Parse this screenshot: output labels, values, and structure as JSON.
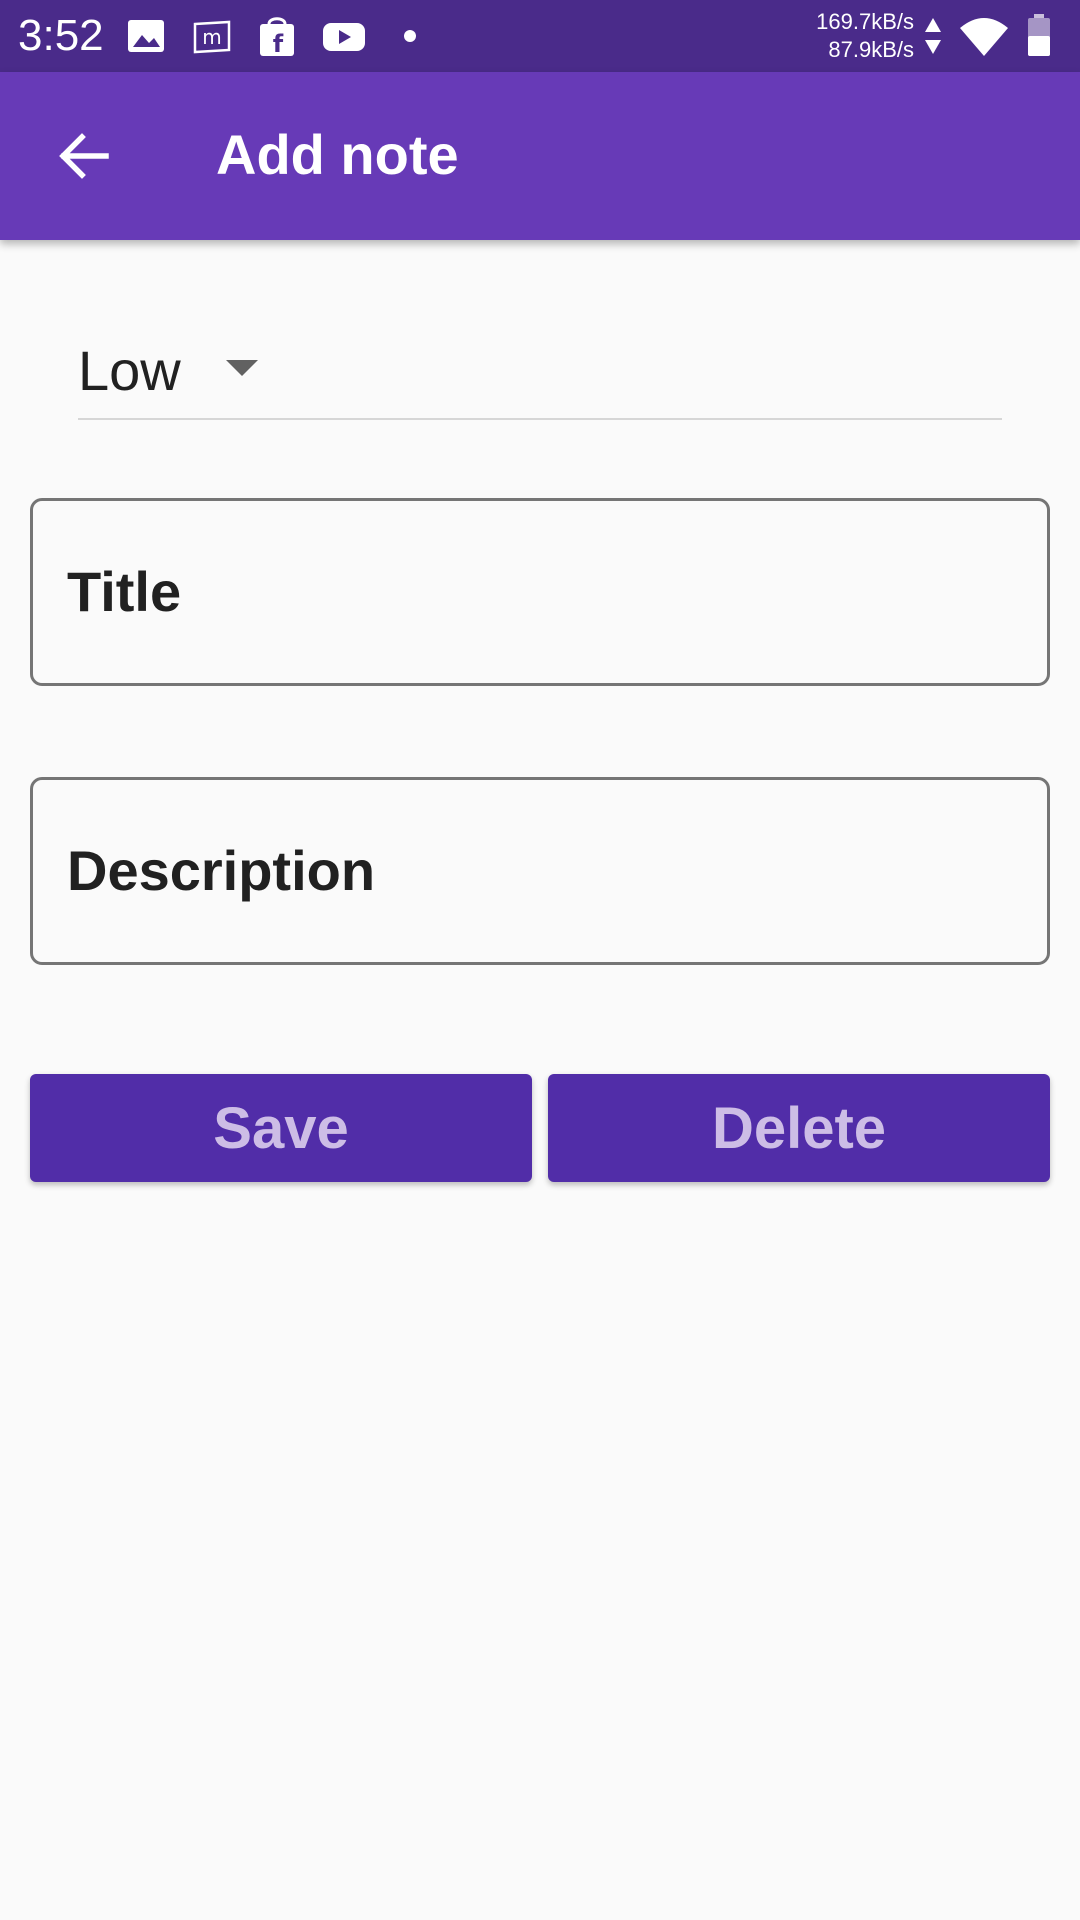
{
  "status_bar": {
    "time": "3:52",
    "icons": [
      "image-icon",
      "mail-app-icon",
      "shopping-bag-icon",
      "youtube-icon",
      "dot-icon"
    ],
    "upload_speed": "169.7kB/s",
    "download_speed": "87.9kB/s",
    "right_icons": [
      "data-arrows-icon",
      "wifi-icon",
      "battery-icon"
    ]
  },
  "app_bar": {
    "title": "Add note",
    "back_icon": "arrow-back-icon",
    "color": "#673ab7"
  },
  "priority": {
    "selected": "Low"
  },
  "form": {
    "title_placeholder": "Title",
    "description_placeholder": "Description"
  },
  "buttons": {
    "save_label": "Save",
    "delete_label": "Delete",
    "color": "#512da8"
  }
}
